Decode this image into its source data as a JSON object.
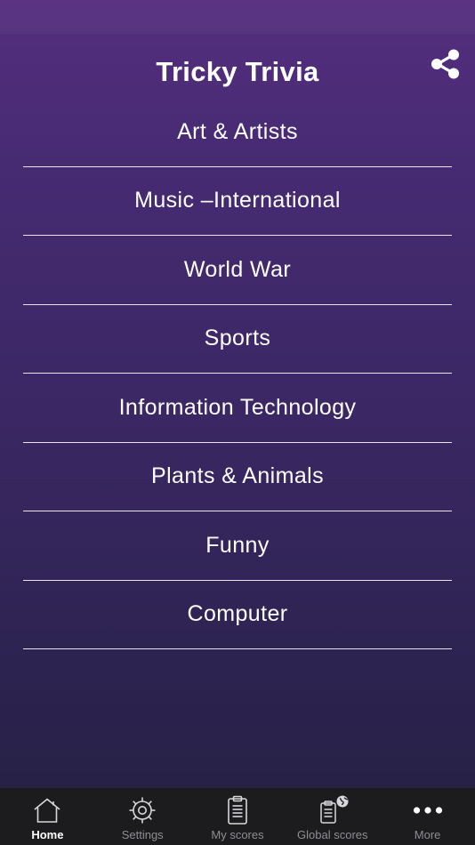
{
  "app": {
    "title": "Tricky Trivia"
  },
  "header": {
    "share_icon": "share-icon"
  },
  "categories": [
    {
      "label": "Art & Artists"
    },
    {
      "label": "Music –International"
    },
    {
      "label": "World War"
    },
    {
      "label": "Sports"
    },
    {
      "label": "Information Technology"
    },
    {
      "label": "Plants & Animals"
    },
    {
      "label": "Funny"
    },
    {
      "label": "Computer"
    }
  ],
  "tabbar": {
    "tabs": [
      {
        "label": "Home",
        "icon": "home-icon",
        "active": true
      },
      {
        "label": "Settings",
        "icon": "gear-icon",
        "active": false
      },
      {
        "label": "My scores",
        "icon": "clipboard-icon",
        "active": false
      },
      {
        "label": "Global scores",
        "icon": "globe-clipboard-icon",
        "active": false
      },
      {
        "label": "More",
        "icon": "more-icon",
        "active": false
      }
    ]
  },
  "colors": {
    "background_top": "#552e7f",
    "background_bottom": "#252041",
    "divider": "#e9e4f0",
    "tabbar_bg": "#1c1c1e",
    "tab_active": "#ffffff",
    "tab_inactive": "#8e8e93"
  }
}
